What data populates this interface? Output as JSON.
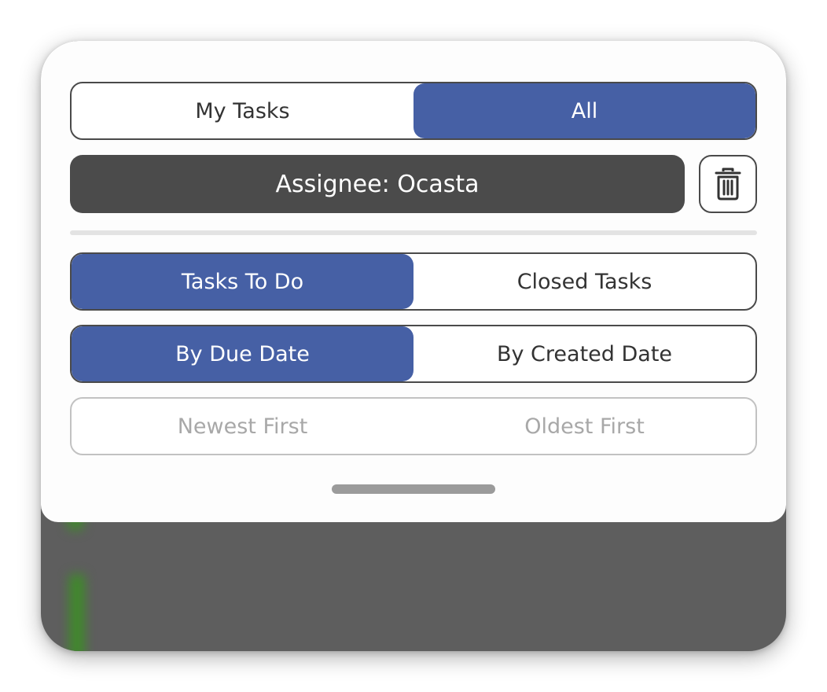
{
  "assignment_filter": {
    "options": [
      "My Tasks",
      "All"
    ],
    "selected": "All"
  },
  "assignee_filter": {
    "label": "Assignee: Ocasta"
  },
  "clear_filter_icon": "trash-icon",
  "status_filter": {
    "options": [
      "Tasks To Do",
      "Closed Tasks"
    ],
    "selected": "Tasks To Do"
  },
  "sort_by": {
    "options": [
      "By Due Date",
      "By Created Date"
    ],
    "selected": "By Due Date"
  },
  "sort_order": {
    "options": [
      "Newest First",
      "Oldest First"
    ],
    "enabled": false
  },
  "colors": {
    "accent": "#4660a5",
    "assignee_bg": "#4b4b4b",
    "task_stripe": "#3f8a2a"
  }
}
